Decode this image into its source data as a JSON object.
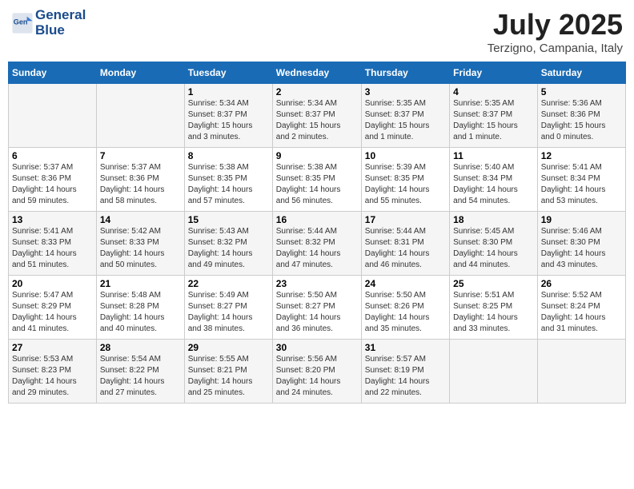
{
  "header": {
    "logo_line1": "General",
    "logo_line2": "Blue",
    "month": "July 2025",
    "location": "Terzigno, Campania, Italy"
  },
  "columns": [
    "Sunday",
    "Monday",
    "Tuesday",
    "Wednesday",
    "Thursday",
    "Friday",
    "Saturday"
  ],
  "weeks": [
    [
      {
        "day": "",
        "info": ""
      },
      {
        "day": "",
        "info": ""
      },
      {
        "day": "1",
        "info": "Sunrise: 5:34 AM\nSunset: 8:37 PM\nDaylight: 15 hours\nand 3 minutes."
      },
      {
        "day": "2",
        "info": "Sunrise: 5:34 AM\nSunset: 8:37 PM\nDaylight: 15 hours\nand 2 minutes."
      },
      {
        "day": "3",
        "info": "Sunrise: 5:35 AM\nSunset: 8:37 PM\nDaylight: 15 hours\nand 1 minute."
      },
      {
        "day": "4",
        "info": "Sunrise: 5:35 AM\nSunset: 8:37 PM\nDaylight: 15 hours\nand 1 minute."
      },
      {
        "day": "5",
        "info": "Sunrise: 5:36 AM\nSunset: 8:36 PM\nDaylight: 15 hours\nand 0 minutes."
      }
    ],
    [
      {
        "day": "6",
        "info": "Sunrise: 5:37 AM\nSunset: 8:36 PM\nDaylight: 14 hours\nand 59 minutes."
      },
      {
        "day": "7",
        "info": "Sunrise: 5:37 AM\nSunset: 8:36 PM\nDaylight: 14 hours\nand 58 minutes."
      },
      {
        "day": "8",
        "info": "Sunrise: 5:38 AM\nSunset: 8:35 PM\nDaylight: 14 hours\nand 57 minutes."
      },
      {
        "day": "9",
        "info": "Sunrise: 5:38 AM\nSunset: 8:35 PM\nDaylight: 14 hours\nand 56 minutes."
      },
      {
        "day": "10",
        "info": "Sunrise: 5:39 AM\nSunset: 8:35 PM\nDaylight: 14 hours\nand 55 minutes."
      },
      {
        "day": "11",
        "info": "Sunrise: 5:40 AM\nSunset: 8:34 PM\nDaylight: 14 hours\nand 54 minutes."
      },
      {
        "day": "12",
        "info": "Sunrise: 5:41 AM\nSunset: 8:34 PM\nDaylight: 14 hours\nand 53 minutes."
      }
    ],
    [
      {
        "day": "13",
        "info": "Sunrise: 5:41 AM\nSunset: 8:33 PM\nDaylight: 14 hours\nand 51 minutes."
      },
      {
        "day": "14",
        "info": "Sunrise: 5:42 AM\nSunset: 8:33 PM\nDaylight: 14 hours\nand 50 minutes."
      },
      {
        "day": "15",
        "info": "Sunrise: 5:43 AM\nSunset: 8:32 PM\nDaylight: 14 hours\nand 49 minutes."
      },
      {
        "day": "16",
        "info": "Sunrise: 5:44 AM\nSunset: 8:32 PM\nDaylight: 14 hours\nand 47 minutes."
      },
      {
        "day": "17",
        "info": "Sunrise: 5:44 AM\nSunset: 8:31 PM\nDaylight: 14 hours\nand 46 minutes."
      },
      {
        "day": "18",
        "info": "Sunrise: 5:45 AM\nSunset: 8:30 PM\nDaylight: 14 hours\nand 44 minutes."
      },
      {
        "day": "19",
        "info": "Sunrise: 5:46 AM\nSunset: 8:30 PM\nDaylight: 14 hours\nand 43 minutes."
      }
    ],
    [
      {
        "day": "20",
        "info": "Sunrise: 5:47 AM\nSunset: 8:29 PM\nDaylight: 14 hours\nand 41 minutes."
      },
      {
        "day": "21",
        "info": "Sunrise: 5:48 AM\nSunset: 8:28 PM\nDaylight: 14 hours\nand 40 minutes."
      },
      {
        "day": "22",
        "info": "Sunrise: 5:49 AM\nSunset: 8:27 PM\nDaylight: 14 hours\nand 38 minutes."
      },
      {
        "day": "23",
        "info": "Sunrise: 5:50 AM\nSunset: 8:27 PM\nDaylight: 14 hours\nand 36 minutes."
      },
      {
        "day": "24",
        "info": "Sunrise: 5:50 AM\nSunset: 8:26 PM\nDaylight: 14 hours\nand 35 minutes."
      },
      {
        "day": "25",
        "info": "Sunrise: 5:51 AM\nSunset: 8:25 PM\nDaylight: 14 hours\nand 33 minutes."
      },
      {
        "day": "26",
        "info": "Sunrise: 5:52 AM\nSunset: 8:24 PM\nDaylight: 14 hours\nand 31 minutes."
      }
    ],
    [
      {
        "day": "27",
        "info": "Sunrise: 5:53 AM\nSunset: 8:23 PM\nDaylight: 14 hours\nand 29 minutes."
      },
      {
        "day": "28",
        "info": "Sunrise: 5:54 AM\nSunset: 8:22 PM\nDaylight: 14 hours\nand 27 minutes."
      },
      {
        "day": "29",
        "info": "Sunrise: 5:55 AM\nSunset: 8:21 PM\nDaylight: 14 hours\nand 25 minutes."
      },
      {
        "day": "30",
        "info": "Sunrise: 5:56 AM\nSunset: 8:20 PM\nDaylight: 14 hours\nand 24 minutes."
      },
      {
        "day": "31",
        "info": "Sunrise: 5:57 AM\nSunset: 8:19 PM\nDaylight: 14 hours\nand 22 minutes."
      },
      {
        "day": "",
        "info": ""
      },
      {
        "day": "",
        "info": ""
      }
    ]
  ]
}
